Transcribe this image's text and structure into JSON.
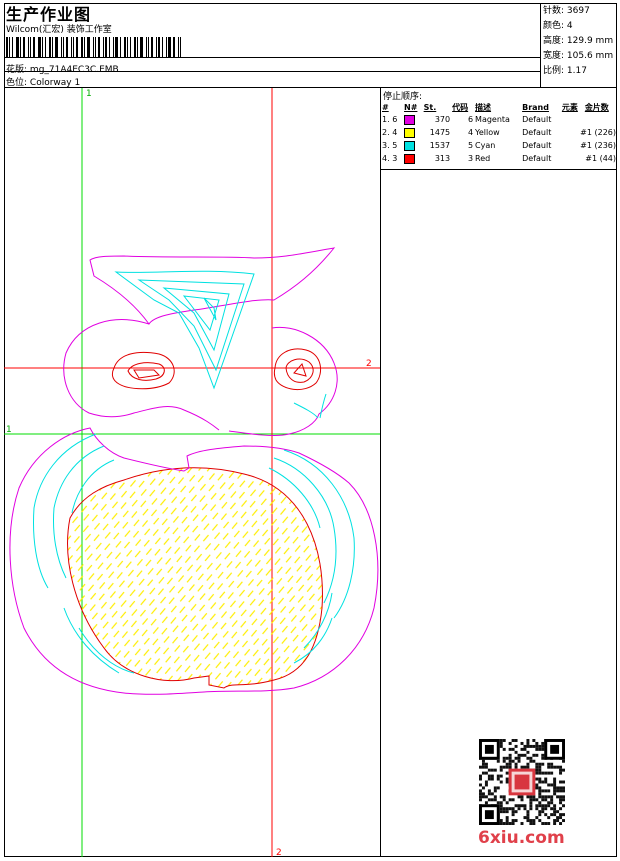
{
  "header": {
    "title": "生产作业图",
    "company": "Wilcom(汇宏) 装饰工作室",
    "design_label": "花版:",
    "design_value": "mg_71A4EC3C.EMB",
    "color_label": "色位:",
    "color_value": "Colorway 1"
  },
  "stats": [
    {
      "label": "针数:",
      "value": "3697"
    },
    {
      "label": "颜色:",
      "value": "4"
    },
    {
      "label": "高度:",
      "value": "129.9 mm"
    },
    {
      "label": "宽度:",
      "value": "105.6 mm"
    },
    {
      "label": "比例:",
      "value": "1.17"
    }
  ],
  "stop_sequence": {
    "title": "停止顺序:",
    "columns": [
      "#",
      "N#",
      "St.",
      "代码",
      "描述",
      "Brand",
      "元素",
      "金片数"
    ],
    "rows": [
      {
        "idx": "1.",
        "n": "6",
        "color": "#e100e1",
        "st": "370",
        "code": "6",
        "desc": "Magenta",
        "brand": "Default",
        "elem": "",
        "seq": ""
      },
      {
        "idx": "2.",
        "n": "4",
        "color": "#ffff00",
        "st": "1475",
        "code": "4",
        "desc": "Yellow",
        "brand": "Default",
        "elem": "#1 (226)",
        "seq": ""
      },
      {
        "idx": "3.",
        "n": "5",
        "color": "#00e1e1",
        "st": "1537",
        "code": "5",
        "desc": "Cyan",
        "brand": "Default",
        "elem": "#1 (236)",
        "seq": ""
      },
      {
        "idx": "4.",
        "n": "3",
        "color": "#ff0000",
        "st": "313",
        "code": "3",
        "desc": "Red",
        "brand": "Default",
        "elem": "#1 (44)",
        "seq": ""
      }
    ]
  },
  "guides": {
    "green_v": "1",
    "green_h": "1",
    "red_h": "2",
    "red_v": "2"
  },
  "colors": {
    "magenta": "#e100e1",
    "cyan": "#00e1e1",
    "yellow": "#ffff00",
    "red": "#ff0000",
    "guide_green": "#00dd00",
    "guide_red": "#ff0000"
  },
  "watermark": "6xiu.com"
}
